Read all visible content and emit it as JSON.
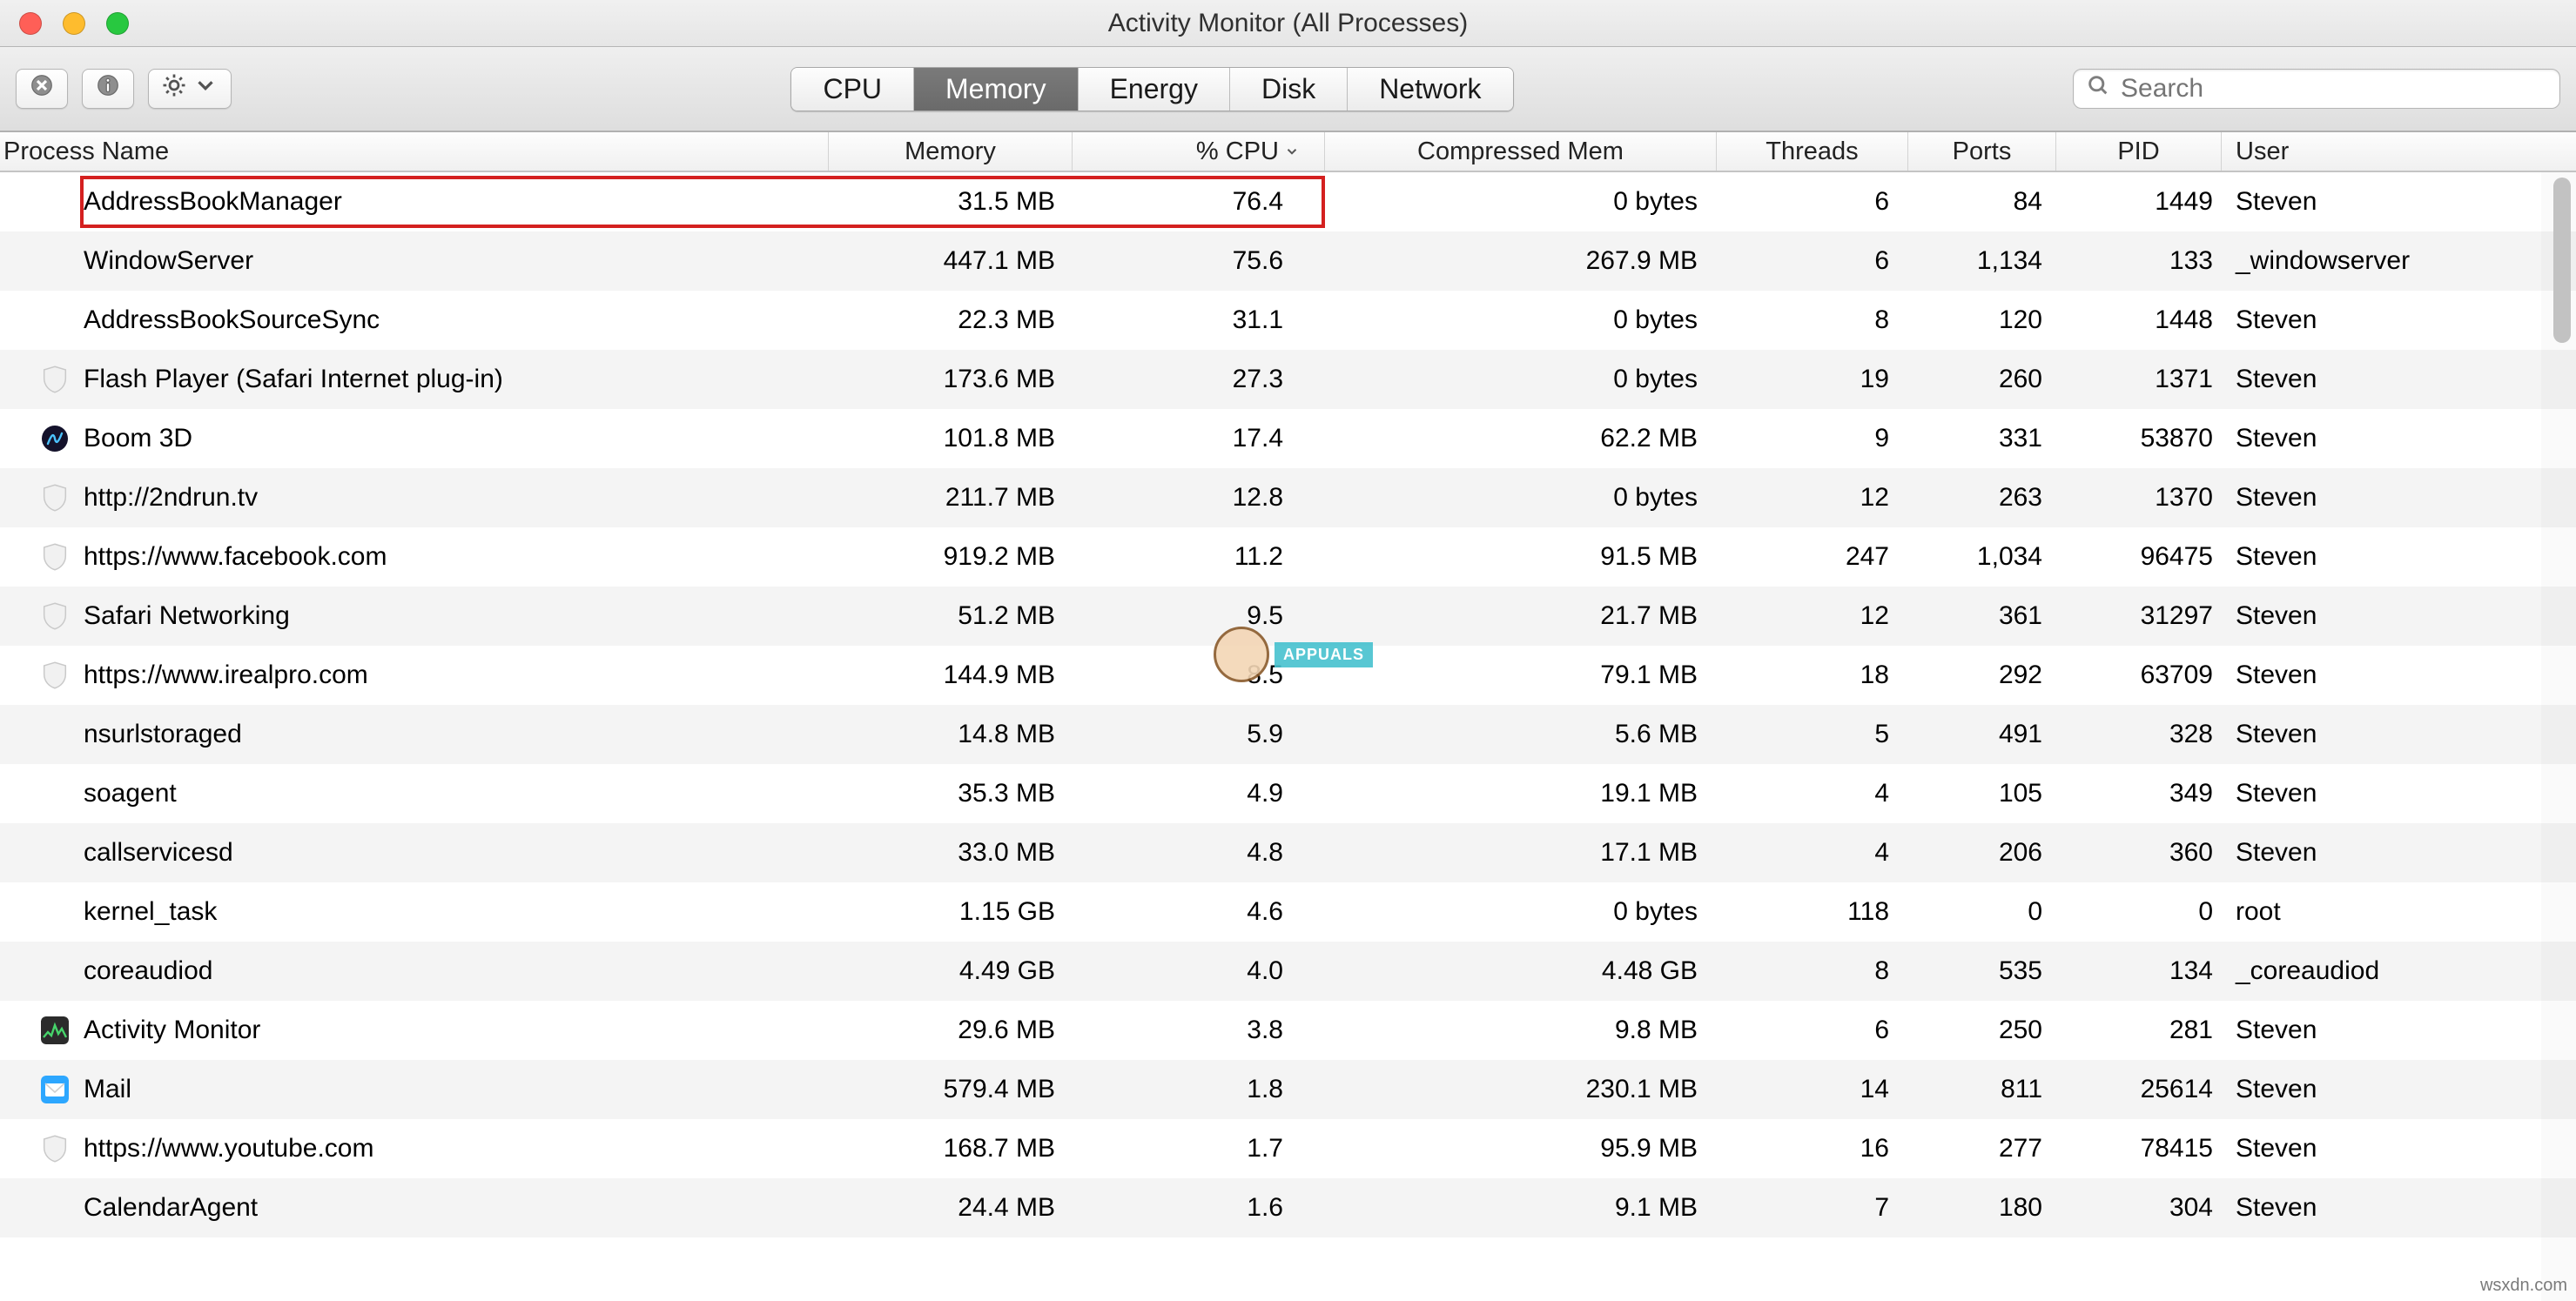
{
  "window": {
    "title": "Activity Monitor (All Processes)"
  },
  "toolbar": {
    "tabs": {
      "cpu": "CPU",
      "memory": "Memory",
      "energy": "Energy",
      "disk": "Disk",
      "network": "Network"
    },
    "active_tab": "memory",
    "search_placeholder": "Search"
  },
  "columns": {
    "name": "Process Name",
    "memory": "Memory",
    "cpu": "% CPU",
    "cmem": "Compressed Mem",
    "threads": "Threads",
    "ports": "Ports",
    "pid": "PID",
    "user": "User"
  },
  "sort": {
    "column": "cpu",
    "direction": "desc"
  },
  "highlight_row_index": 0,
  "rows": [
    {
      "icon": "none",
      "name": "AddressBookManager",
      "memory": "31.5 MB",
      "cpu": "76.4",
      "cmem": "0 bytes",
      "threads": "6",
      "ports": "84",
      "pid": "1449",
      "user": "Steven"
    },
    {
      "icon": "none",
      "name": "WindowServer",
      "memory": "447.1 MB",
      "cpu": "75.6",
      "cmem": "267.9 MB",
      "threads": "6",
      "ports": "1,134",
      "pid": "133",
      "user": "_windowserver"
    },
    {
      "icon": "none",
      "name": "AddressBookSourceSync",
      "memory": "22.3 MB",
      "cpu": "31.1",
      "cmem": "0 bytes",
      "threads": "8",
      "ports": "120",
      "pid": "1448",
      "user": "Steven"
    },
    {
      "icon": "shield",
      "name": "Flash Player (Safari Internet plug-in)",
      "memory": "173.6 MB",
      "cpu": "27.3",
      "cmem": "0 bytes",
      "threads": "19",
      "ports": "260",
      "pid": "1371",
      "user": "Steven"
    },
    {
      "icon": "boom",
      "name": "Boom 3D",
      "memory": "101.8 MB",
      "cpu": "17.4",
      "cmem": "62.2 MB",
      "threads": "9",
      "ports": "331",
      "pid": "53870",
      "user": "Steven"
    },
    {
      "icon": "shield",
      "name": "http://2ndrun.tv",
      "memory": "211.7 MB",
      "cpu": "12.8",
      "cmem": "0 bytes",
      "threads": "12",
      "ports": "263",
      "pid": "1370",
      "user": "Steven"
    },
    {
      "icon": "shield",
      "name": "https://www.facebook.com",
      "memory": "919.2 MB",
      "cpu": "11.2",
      "cmem": "91.5 MB",
      "threads": "247",
      "ports": "1,034",
      "pid": "96475",
      "user": "Steven"
    },
    {
      "icon": "shield",
      "name": "Safari Networking",
      "memory": "51.2 MB",
      "cpu": "9.5",
      "cmem": "21.7 MB",
      "threads": "12",
      "ports": "361",
      "pid": "31297",
      "user": "Steven"
    },
    {
      "icon": "shield",
      "name": "https://www.irealpro.com",
      "memory": "144.9 MB",
      "cpu": "8.5",
      "cmem": "79.1 MB",
      "threads": "18",
      "ports": "292",
      "pid": "63709",
      "user": "Steven"
    },
    {
      "icon": "none",
      "name": "nsurlstoraged",
      "memory": "14.8 MB",
      "cpu": "5.9",
      "cmem": "5.6 MB",
      "threads": "5",
      "ports": "491",
      "pid": "328",
      "user": "Steven"
    },
    {
      "icon": "none",
      "name": "soagent",
      "memory": "35.3 MB",
      "cpu": "4.9",
      "cmem": "19.1 MB",
      "threads": "4",
      "ports": "105",
      "pid": "349",
      "user": "Steven"
    },
    {
      "icon": "none",
      "name": "callservicesd",
      "memory": "33.0 MB",
      "cpu": "4.8",
      "cmem": "17.1 MB",
      "threads": "4",
      "ports": "206",
      "pid": "360",
      "user": "Steven"
    },
    {
      "icon": "none",
      "name": "kernel_task",
      "memory": "1.15 GB",
      "cpu": "4.6",
      "cmem": "0 bytes",
      "threads": "118",
      "ports": "0",
      "pid": "0",
      "user": "root"
    },
    {
      "icon": "none",
      "name": "coreaudiod",
      "memory": "4.49 GB",
      "cpu": "4.0",
      "cmem": "4.48 GB",
      "threads": "8",
      "ports": "535",
      "pid": "134",
      "user": "_coreaudiod"
    },
    {
      "icon": "am",
      "name": "Activity Monitor",
      "memory": "29.6 MB",
      "cpu": "3.8",
      "cmem": "9.8 MB",
      "threads": "6",
      "ports": "250",
      "pid": "281",
      "user": "Steven"
    },
    {
      "icon": "mail",
      "name": "Mail",
      "memory": "579.4 MB",
      "cpu": "1.8",
      "cmem": "230.1 MB",
      "threads": "14",
      "ports": "811",
      "pid": "25614",
      "user": "Steven"
    },
    {
      "icon": "shield",
      "name": "https://www.youtube.com",
      "memory": "168.7 MB",
      "cpu": "1.7",
      "cmem": "95.9 MB",
      "threads": "16",
      "ports": "277",
      "pid": "78415",
      "user": "Steven"
    },
    {
      "icon": "none",
      "name": "CalendarAgent",
      "memory": "24.4 MB",
      "cpu": "1.6",
      "cmem": "9.1 MB",
      "threads": "7",
      "ports": "180",
      "pid": "304",
      "user": "Steven"
    }
  ],
  "watermark": {
    "label": "APPUALS"
  },
  "footer": {
    "credit": "wsxdn.com"
  }
}
